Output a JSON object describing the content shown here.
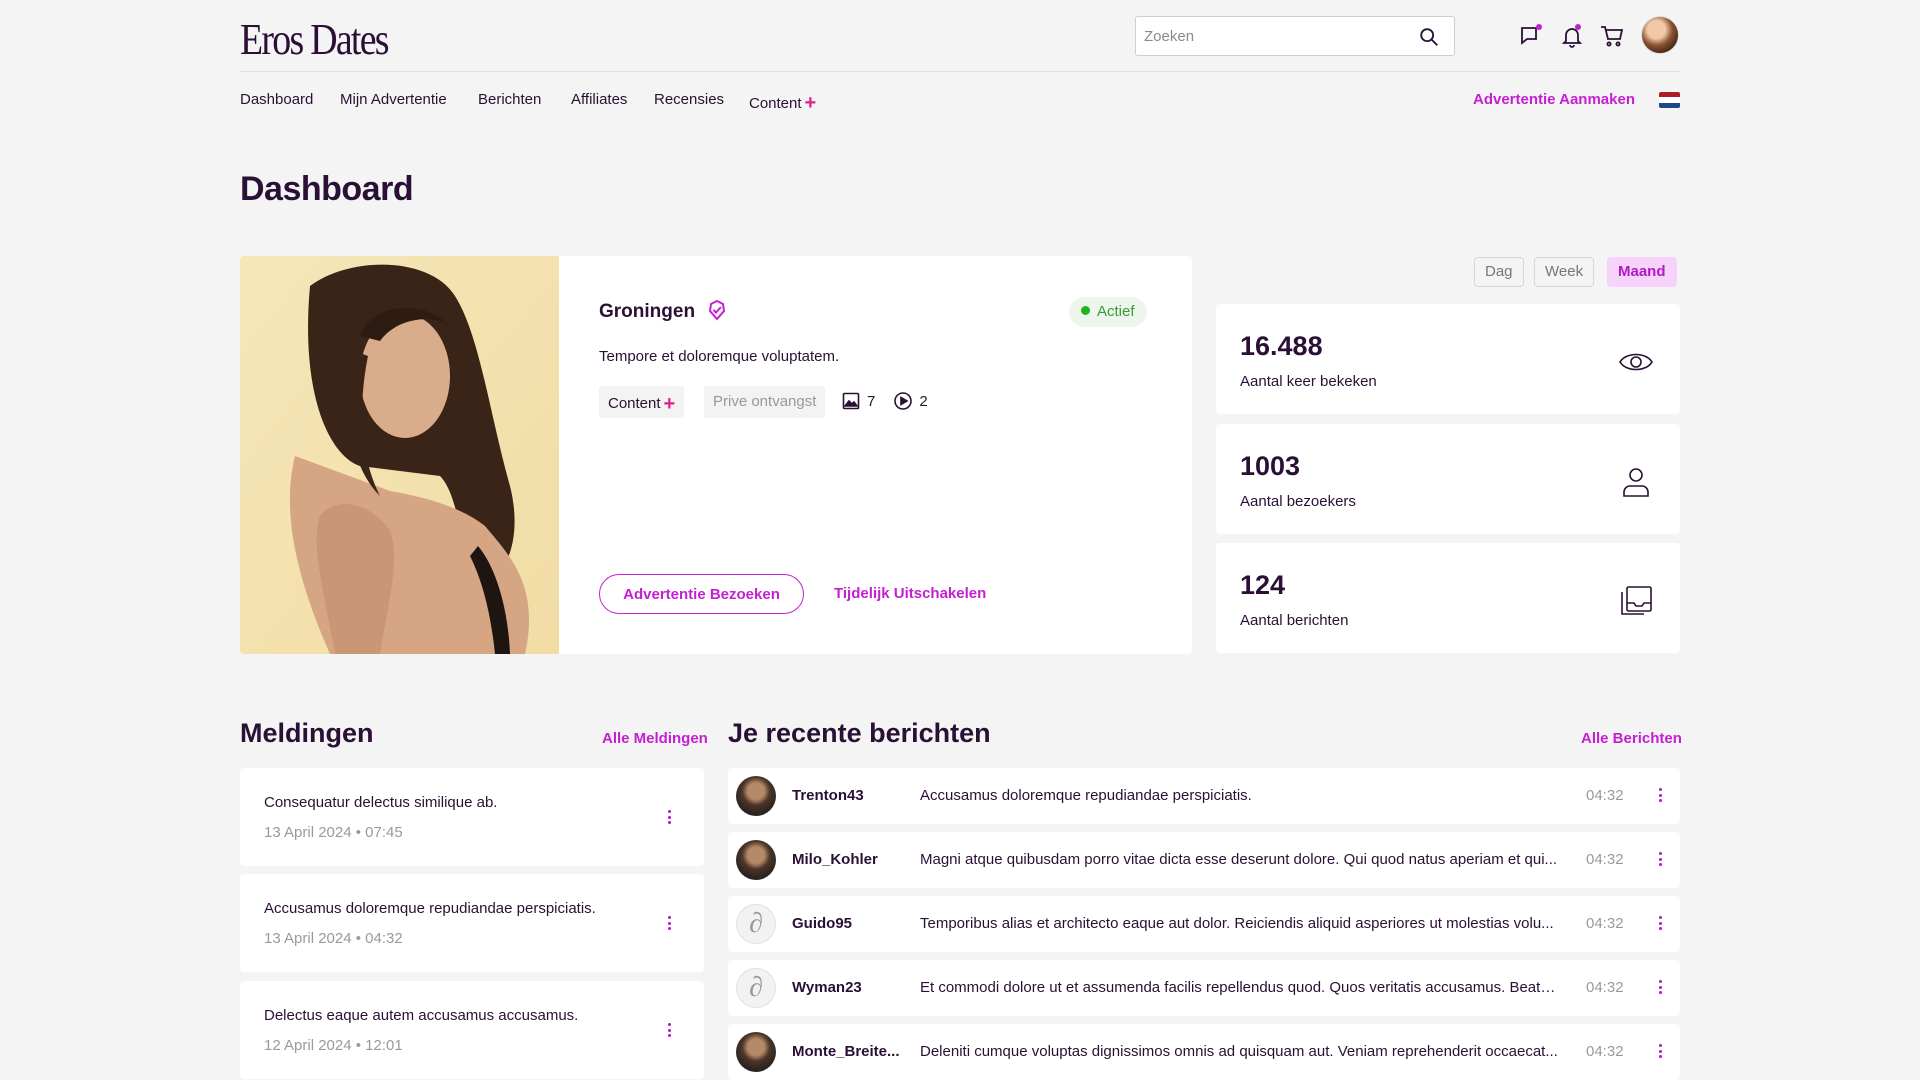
{
  "header": {
    "logo": "Eros Dates",
    "search_placeholder": "Zoeken",
    "icons": [
      "chat-icon",
      "bell-icon",
      "cart-icon"
    ],
    "notification_dot_color": "#c41fd1"
  },
  "nav": {
    "items": [
      "Dashboard",
      "Mijn Advertentie",
      "Berichten",
      "Affiliates",
      "Recensies",
      "Content"
    ],
    "create_label": "Advertentie Aanmaken",
    "language": "NL"
  },
  "page": {
    "title": "Dashboard"
  },
  "profile": {
    "city": "Groningen",
    "status": "Actief",
    "description": "Tempore et doloremque voluptatem.",
    "content_chip": "Content",
    "prive_chip": "Prive ontvangst",
    "image_count": "7",
    "video_count": "2",
    "visit_button": "Advertentie Bezoeken",
    "disable_link": "Tijdelijk Uitschakelen"
  },
  "period": {
    "options": [
      "Dag",
      "Week",
      "Maand"
    ],
    "selected": "Maand"
  },
  "stats": [
    {
      "value": "16.488",
      "label": "Aantal keer bekeken",
      "icon": "eye-icon"
    },
    {
      "value": "1003",
      "label": "Aantal bezoekers",
      "icon": "user-icon"
    },
    {
      "value": "124",
      "label": "Aantal berichten",
      "icon": "inbox-icon"
    }
  ],
  "notifications": {
    "title": "Meldingen",
    "all_link": "Alle Meldingen",
    "items": [
      {
        "text": "Consequatur delectus similique ab.",
        "date": "13 April 2024 • 07:45"
      },
      {
        "text": "Accusamus doloremque repudiandae perspiciatis.",
        "date": "13 April 2024 • 04:32"
      },
      {
        "text": "Delectus eaque autem accusamus accusamus.",
        "date": "12 April 2024 • 12:01"
      }
    ]
  },
  "messages": {
    "title": "Je recente berichten",
    "all_link": "Alle Berichten",
    "items": [
      {
        "user": "Trenton43",
        "text": "Accusamus doloremque repudiandae perspiciatis.",
        "time": "04:32",
        "avatar": "photo"
      },
      {
        "user": "Milo_Kohler",
        "text": "Magni atque quibusdam porro vitae dicta esse deserunt dolore. Qui quod natus aperiam et qui...",
        "time": "04:32",
        "avatar": "photo"
      },
      {
        "user": "Guido95",
        "text": "Temporibus alias et architecto eaque aut dolor. Reiciendis aliquid asperiores ut molestias volu...",
        "time": "04:32",
        "avatar": "logo"
      },
      {
        "user": "Wyman23",
        "text": "Et commodi dolore ut et assumenda facilis repellendus quod. Quos veritatis accusamus. Beata...",
        "time": "04:32",
        "avatar": "logo"
      },
      {
        "user": "Monte_Breite...",
        "text": "Deleniti cumque voluptas dignissimos omnis ad quisquam aut. Veniam reprehenderit occaecat...",
        "time": "04:32",
        "avatar": "photo"
      }
    ]
  },
  "colors": {
    "accent": "#c41fd1",
    "text": "#2a1035",
    "active_green": "#1fb31f",
    "plus": "#e0218a"
  }
}
